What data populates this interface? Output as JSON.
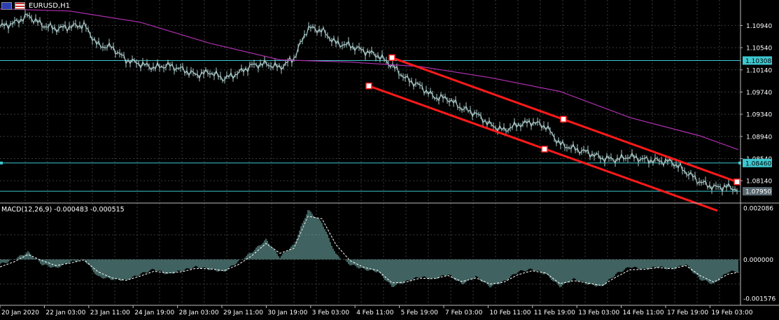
{
  "header": {
    "symbol": "EURUSD,H1"
  },
  "macd": {
    "label": "MACD(12,26,9) -0.000483 -0.000515"
  },
  "colors": {
    "background": "#000000",
    "grid": "#3a3a3a",
    "candles": "#a8c8c8",
    "ma_line": "#b030b0",
    "trend_line": "#ff1a1a",
    "hline": "#3ec8d0",
    "macd_hist": "#7fc4c0",
    "signal": "#ffffff"
  },
  "chart_data": [
    {
      "type": "line",
      "title": "EURUSD,H1",
      "price_axis_labels": [
        "1.10940",
        "1.10540",
        "1.10140",
        "1.09740",
        "1.09340",
        "1.08940",
        "1.08540",
        "1.08140"
      ],
      "ylim": [
        1.0775,
        1.114
      ],
      "x_tick_labels": [
        "20 Jan 2020",
        "22 Jan 03:00",
        "23 Jan 11:00",
        "24 Jan 19:00",
        "28 Jan 03:00",
        "29 Jan 11:00",
        "30 Jan 19:00",
        "3 Feb 03:00",
        "4 Feb 11:00",
        "5 Feb 19:00",
        "7 Feb 03:00",
        "10 Feb 11:00",
        "11 Feb 19:00",
        "13 Feb 03:00",
        "14 Feb 11:00",
        "17 Feb 19:00",
        "19 Feb 03:00"
      ],
      "price_series_x": [
        0,
        20,
        40,
        60,
        80,
        100,
        120,
        140,
        160,
        180,
        200,
        220,
        240,
        260,
        280,
        300,
        320,
        340,
        360,
        380,
        400,
        420,
        440,
        460,
        480,
        500,
        520,
        540,
        560,
        580,
        600,
        620,
        640,
        660,
        680,
        700,
        720,
        740,
        760,
        780,
        800,
        820,
        840,
        860,
        880,
        900,
        920,
        940,
        960,
        980,
        1000,
        1020,
        1040,
        1055
      ],
      "price_series_y": [
        1.1092,
        1.1098,
        1.1112,
        1.1095,
        1.1088,
        1.1092,
        1.1095,
        1.1058,
        1.1055,
        1.1032,
        1.1025,
        1.1018,
        1.1022,
        1.1015,
        1.1005,
        1.101,
        1.0998,
        1.1008,
        1.1022,
        1.1025,
        1.1018,
        1.1035,
        1.109,
        1.1085,
        1.1062,
        1.1058,
        1.1048,
        1.104,
        1.1022,
        1.0998,
        1.0985,
        1.0965,
        1.0962,
        1.0945,
        1.0935,
        1.0915,
        1.0905,
        1.0915,
        1.092,
        1.0912,
        1.088,
        1.0872,
        1.0865,
        1.0855,
        1.0852,
        1.0858,
        1.0852,
        1.085,
        1.0848,
        1.083,
        1.0812,
        1.0802,
        1.0803,
        1.0798
      ],
      "moving_average_x": [
        0,
        100,
        200,
        300,
        400,
        500,
        600,
        700,
        800,
        900,
        1000,
        1055
      ],
      "moving_average_y": [
        1.1124,
        1.112,
        1.11,
        1.1062,
        1.1032,
        1.1028,
        1.102,
        1.1,
        1.0975,
        1.0928,
        1.0895,
        1.087
      ],
      "horizontal_lines": [
        {
          "value": 1.10308,
          "label": "1.10308"
        },
        {
          "value": 1.0846,
          "label": "1.08460"
        },
        {
          "value": 1.0795,
          "label": "1.07950"
        }
      ],
      "trend_lines": [
        {
          "x1": 560,
          "y1": 1.1036,
          "x2": 1053,
          "y2": 1.0812
        },
        {
          "x1": 527,
          "y1": 1.0985,
          "x2": 1025,
          "y2": 1.076
        }
      ],
      "trend_anchor_points": [
        {
          "x": 560,
          "y": 1.1036
        },
        {
          "x": 805,
          "y": 1.0925
        },
        {
          "x": 1053,
          "y": 1.0812
        },
        {
          "x": 527,
          "y": 1.0985
        },
        {
          "x": 778,
          "y": 1.0871
        }
      ]
    },
    {
      "type": "bar",
      "title": "MACD(12,26,9) -0.000483 -0.000515",
      "axis_labels": [
        "0.002086",
        "0.000000",
        "-0.001576"
      ],
      "ylim": [
        -0.001576,
        0.002086
      ],
      "macd_x": [
        0,
        20,
        40,
        60,
        80,
        100,
        120,
        140,
        160,
        180,
        200,
        220,
        240,
        260,
        280,
        300,
        320,
        340,
        360,
        380,
        400,
        420,
        440,
        460,
        480,
        500,
        520,
        540,
        560,
        580,
        600,
        620,
        640,
        660,
        680,
        700,
        720,
        740,
        760,
        780,
        800,
        820,
        840,
        860,
        880,
        900,
        920,
        940,
        960,
        980,
        1000,
        1020,
        1040,
        1055
      ],
      "macd_y": [
        -0.0002,
        0.0,
        0.0003,
        -0.0002,
        -0.00035,
        -0.0001,
        0.0,
        -0.0007,
        -0.0008,
        -0.00085,
        -0.0006,
        -0.0004,
        -0.0006,
        -0.00045,
        -0.0003,
        -0.0004,
        -0.0005,
        -0.0001,
        0.0003,
        0.0008,
        0.0001,
        0.0006,
        0.002,
        0.0015,
        0.0002,
        -0.0002,
        -0.0004,
        -0.0005,
        -0.0011,
        -0.0009,
        -0.0007,
        -0.0008,
        -0.0006,
        -0.001,
        -0.0007,
        -0.0011,
        -0.0009,
        -0.0005,
        -0.0004,
        -0.0006,
        -0.0011,
        -0.0008,
        -0.001,
        -0.0011,
        -0.0006,
        -0.0003,
        -0.0004,
        -0.0003,
        -0.0004,
        -0.0002,
        -0.0008,
        -0.001,
        -0.0005,
        -0.00048
      ],
      "signal_x": [
        0,
        20,
        40,
        60,
        80,
        100,
        120,
        140,
        160,
        180,
        200,
        220,
        240,
        260,
        280,
        300,
        320,
        340,
        360,
        380,
        400,
        420,
        440,
        460,
        480,
        500,
        520,
        540,
        560,
        580,
        600,
        620,
        640,
        660,
        680,
        700,
        720,
        740,
        760,
        780,
        800,
        820,
        840,
        860,
        880,
        900,
        920,
        940,
        960,
        980,
        1000,
        1020,
        1040,
        1055
      ],
      "signal_y": [
        -0.0003,
        -0.0001,
        0.0002,
        -5e-05,
        -0.00025,
        -0.00015,
        -2e-05,
        -0.0005,
        -0.00075,
        -0.00085,
        -0.00068,
        -0.00048,
        -0.00055,
        -0.0005,
        -0.00036,
        -0.00038,
        -0.00046,
        -0.00022,
        0.00015,
        0.00065,
        0.00025,
        0.00045,
        0.00175,
        0.00165,
        0.0006,
        -5e-05,
        -0.00032,
        -0.00045,
        -0.00095,
        -0.00092,
        -0.00076,
        -0.00078,
        -0.00065,
        -0.0009,
        -0.00075,
        -0.001,
        -0.00092,
        -0.00062,
        -0.00046,
        -0.00055,
        -0.00098,
        -0.00086,
        -0.00096,
        -0.00106,
        -0.00072,
        -0.00042,
        -0.0004,
        -0.00033,
        -0.00038,
        -0.00025,
        -0.00065,
        -0.00092,
        -0.0006,
        -0.00052
      ]
    }
  ]
}
